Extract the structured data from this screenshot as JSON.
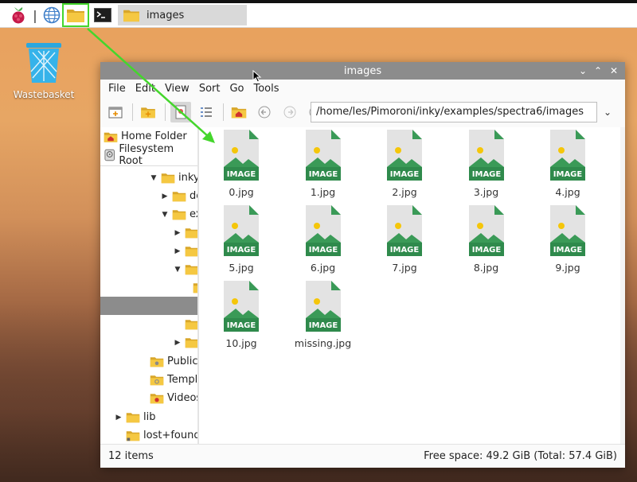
{
  "taskbar": {
    "apps": [
      {
        "name": "raspberry-menu-icon"
      },
      {
        "name": "web-browser-icon"
      },
      {
        "name": "file-manager-icon"
      },
      {
        "name": "terminal-icon"
      }
    ],
    "task_window_label": "images"
  },
  "desktop": {
    "wastebasket_label": "Wastebasket"
  },
  "window": {
    "title": "images",
    "menu": [
      "File",
      "Edit",
      "View",
      "Sort",
      "Go",
      "Tools"
    ],
    "path": "/home/les/Pimoroni/inky/examples/spectra6/images",
    "sidebar": {
      "places": [
        {
          "label": "Home Folder",
          "icon": "home-icon"
        },
        {
          "label": "Filesystem Root",
          "icon": "drive-icon"
        }
      ],
      "tree": [
        {
          "label": "inky",
          "expanded": true
        },
        {
          "label": "do",
          "expanded": false
        },
        {
          "label": "ex",
          "expanded": true
        },
        {
          "label": "",
          "expanded": false
        },
        {
          "label": "",
          "expanded": false
        },
        {
          "label": "",
          "expanded": true
        },
        {
          "label": "",
          "expanded": false
        },
        {
          "label": "Public"
        },
        {
          "label": "Templa"
        },
        {
          "label": "Videos"
        },
        {
          "label": "lib",
          "expanded": false
        },
        {
          "label": "lost+found"
        }
      ]
    },
    "files": [
      {
        "name": "0.jpg"
      },
      {
        "name": "1.jpg"
      },
      {
        "name": "2.jpg"
      },
      {
        "name": "3.jpg"
      },
      {
        "name": "4.jpg"
      },
      {
        "name": "5.jpg"
      },
      {
        "name": "6.jpg"
      },
      {
        "name": "7.jpg"
      },
      {
        "name": "8.jpg"
      },
      {
        "name": "9.jpg"
      },
      {
        "name": "10.jpg"
      },
      {
        "name": "missing.jpg"
      }
    ],
    "file_type_badge": "IMAGE",
    "status": {
      "count": "12 items",
      "free_space": "Free space: 49.2 GiB (Total: 57.4 GiB)"
    }
  },
  "colors": {
    "highlight": "#44d62c",
    "folder": "#f5c842",
    "image_green": "#3a9a57",
    "titlebar": "#8c8c8c"
  }
}
